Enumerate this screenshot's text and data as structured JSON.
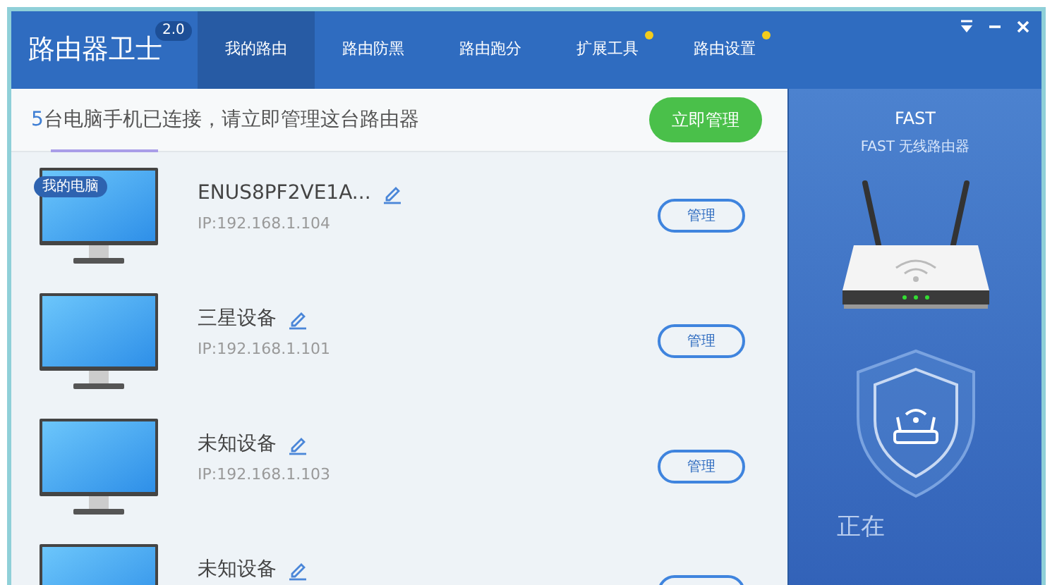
{
  "app": {
    "title": "路由器卫士",
    "version": "2.0"
  },
  "tabs": [
    {
      "label": "我的路由",
      "selected": true,
      "dot": false
    },
    {
      "label": "路由防黑",
      "selected": false,
      "dot": false
    },
    {
      "label": "路由跑分",
      "selected": false,
      "dot": false
    },
    {
      "label": "扩展工具",
      "selected": false,
      "dot": true
    },
    {
      "label": "路由设置",
      "selected": false,
      "dot": true
    }
  ],
  "summary": {
    "count": "5",
    "text": "台电脑手机已连接，请立即管理这台路由器",
    "button": "立即管理"
  },
  "devices": [
    {
      "name": "ENUS8PF2VE1A...",
      "ip": "IP:192.168.1.104",
      "badge": "我的电脑",
      "button": "管理"
    },
    {
      "name": "三星设备",
      "ip": "IP:192.168.1.101",
      "button": "管理"
    },
    {
      "name": "未知设备",
      "ip": "IP:192.168.1.103",
      "button": "管理"
    },
    {
      "name": "未知设备"
    }
  ],
  "router": {
    "brand": "FAST",
    "model": "FAST 无线路由器",
    "status": "正在"
  }
}
